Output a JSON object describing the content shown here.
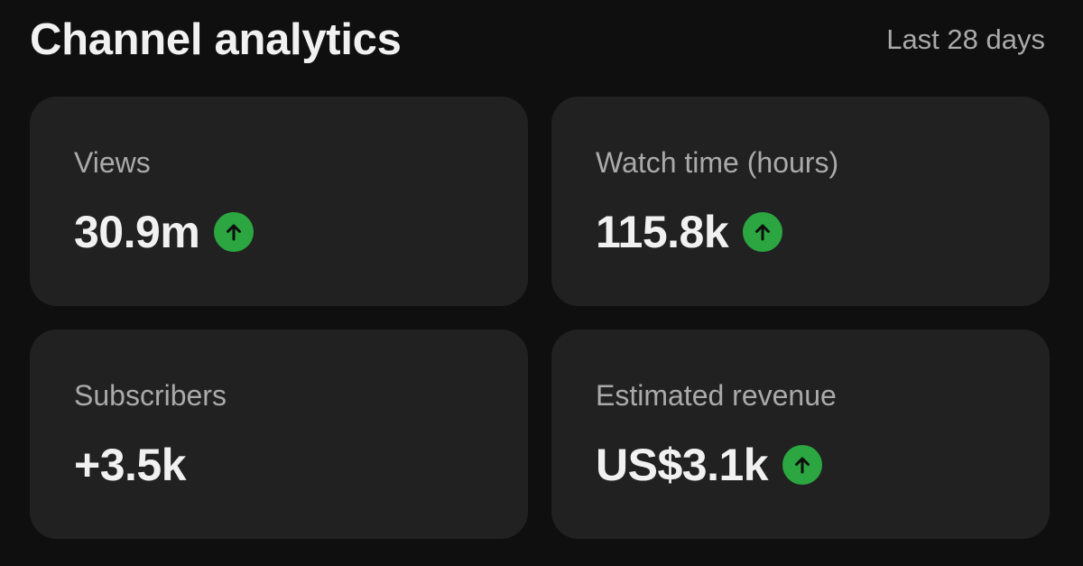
{
  "header": {
    "title": "Channel analytics",
    "period": "Last 28 days"
  },
  "metrics": [
    {
      "label": "Views",
      "value": "30.9m",
      "trend": "up"
    },
    {
      "label": "Watch time (hours)",
      "value": "115.8k",
      "trend": "up"
    },
    {
      "label": "Subscribers",
      "value": "+3.5k",
      "trend": "none"
    },
    {
      "label": "Estimated revenue",
      "value": "US$3.1k",
      "trend": "up"
    }
  ],
  "colors": {
    "background": "#0f0f0f",
    "card": "#212121",
    "trend_up": "#2ba640",
    "label_text": "#aaaaaa",
    "value_text": "#f1f1f1"
  },
  "icons": {
    "trend_up": "arrow-up-icon"
  }
}
